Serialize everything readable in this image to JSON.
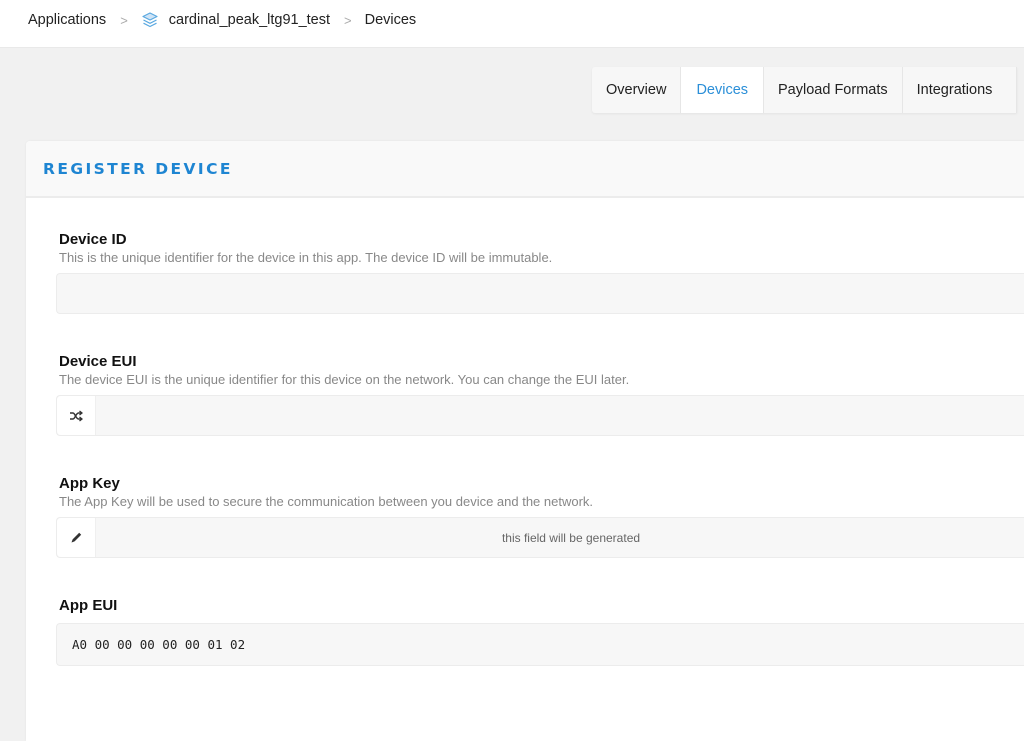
{
  "breadcrumb": {
    "items": [
      {
        "label": "Applications",
        "icon": null
      },
      {
        "label": "cardinal_peak_ltg91_test",
        "icon": "stack-layers-icon"
      },
      {
        "label": "Devices",
        "icon": null
      }
    ],
    "separator": ">"
  },
  "tabs": [
    {
      "label": "Overview",
      "active": false
    },
    {
      "label": "Devices",
      "active": true
    },
    {
      "label": "Payload Formats",
      "active": false
    },
    {
      "label": "Integrations",
      "active": false
    }
  ],
  "colors": {
    "accent": "#1e85d2",
    "active_tab": "#2b8fd8",
    "app_icon": "#5aa8e0"
  },
  "card": {
    "title": "REGISTER DEVICE"
  },
  "form": {
    "device_id": {
      "label": "Device ID",
      "description": "This is the unique identifier for the device in this app. The device ID will be immutable.",
      "value": "",
      "placeholder": ""
    },
    "device_eui": {
      "label": "Device EUI",
      "description": "The device EUI is the unique identifier for this device on the network. You can change the EUI later.",
      "addon_icon": "shuffle-icon",
      "value": "",
      "placeholder": ""
    },
    "app_key": {
      "label": "App Key",
      "description": "The App Key will be used to secure the communication between you device and the network.",
      "addon_icon": "pencil-icon",
      "value": "",
      "placeholder": "this field will be generated"
    },
    "app_eui": {
      "label": "App EUI",
      "value": "A0 00 00 00 00 00 01 02"
    }
  }
}
